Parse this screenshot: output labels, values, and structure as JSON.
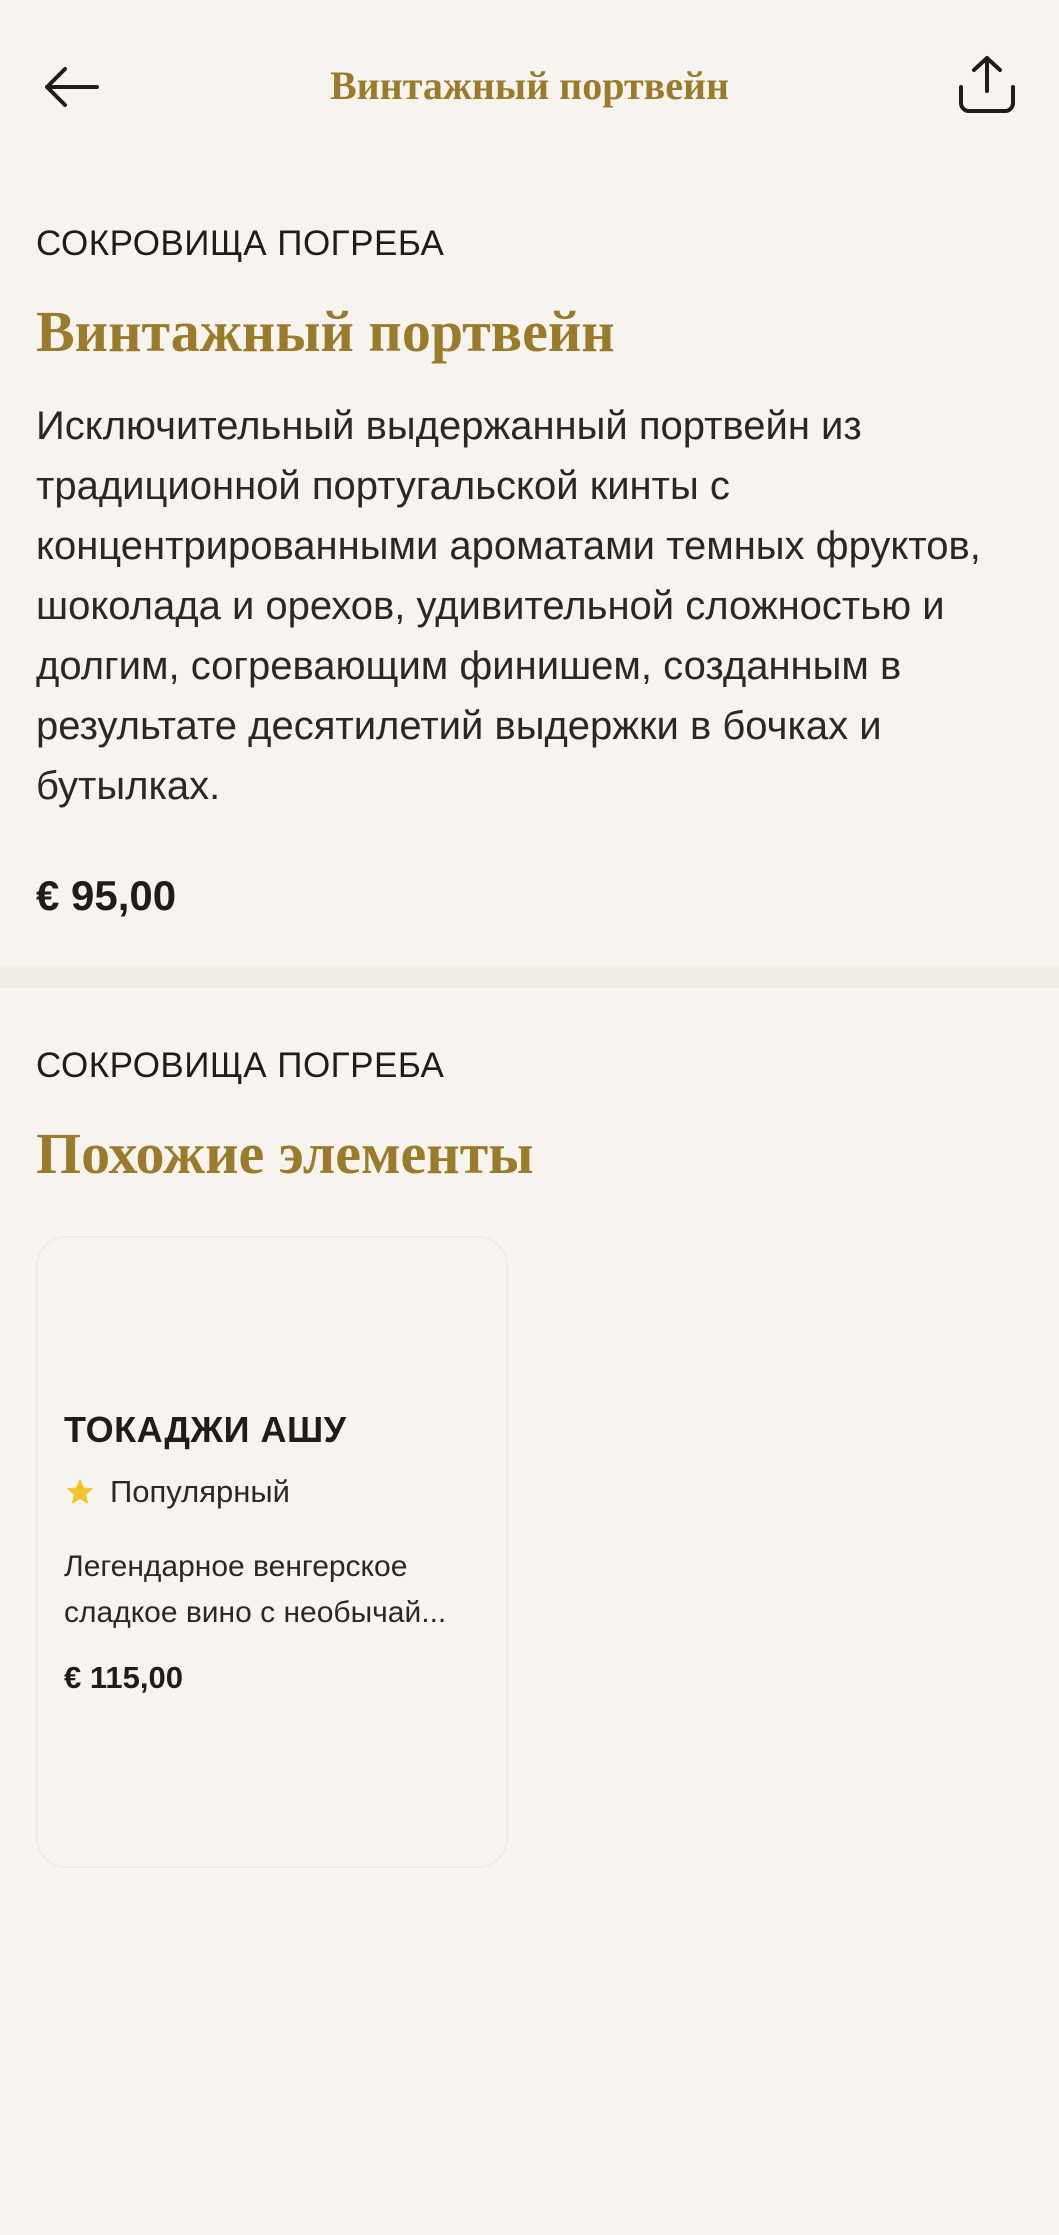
{
  "header": {
    "title": "Винтажный портвейн",
    "back_icon": "arrow-left-icon",
    "share_icon": "share-icon"
  },
  "product": {
    "category": "СОКРОВИЩА ПОГРЕБА",
    "title": "Винтажный портвейн",
    "description": "Исключительный выдержанный портвейн из традиционной португальской кинты с концентрированными ароматами темных фруктов, шоколада и орехов, удивительной сложностью и долгим, согревающим финишем, созданным в результате десятилетий выдержки в бочках и бутылках.",
    "price": "€ 95,00"
  },
  "similar": {
    "category": "СОКРОВИЩА ПОГРЕБА",
    "title": "Похожие элементы",
    "items": [
      {
        "name": "ТОКАДЖИ АШУ",
        "badge": "Популярный",
        "badge_icon": "star-icon",
        "description": "Легендарное венгерское сладкое вино с необычай...",
        "price": "€ 115,00"
      }
    ]
  },
  "colors": {
    "background": "#f7f4ef",
    "accent_gold": "#9a7b2c",
    "star": "#f2c42b",
    "text": "#1f1d19"
  }
}
